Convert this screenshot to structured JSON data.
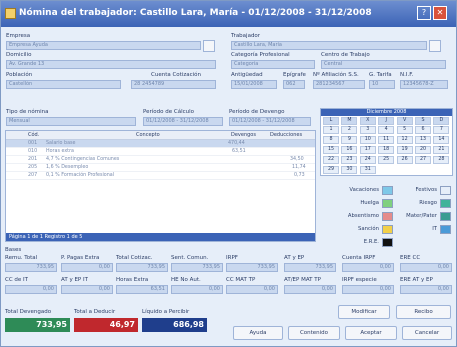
{
  "window": {
    "title": "Nómina del trabajador: Castillo Lara, María - 01/12/2008 - 31/12/2008"
  },
  "labels": {
    "empresa": "Empresa",
    "trabajador": "Trabajador",
    "domicilio": "Domicilio",
    "categoria": "Categoría Profesional",
    "centro": "Centro de Trabajo",
    "poblacion": "Población",
    "cuenta_cotizacion": "Cuenta Cotización",
    "antiguedad": "Antigüedad",
    "epigrafe": "Epígrafe",
    "afiliacion": "Nº Afiliación S.S.",
    "g_tarifa": "G. Tarifa",
    "nif": "N.I.F.",
    "tipo_nomina": "Tipo de nómina",
    "periodo_calculo": "Período de Cálculo",
    "periodo_devengo": "Período de Devengo",
    "bases": "Bases"
  },
  "fields": {
    "empresa": "Empresa Ayuda",
    "trabajador": "Castillo Lara, María",
    "domicilio": "Av. Grande 13",
    "categoria": "Categoría",
    "centro": "Central",
    "poblacion": "Castellón",
    "cuenta_cotizacion": "28 2454789",
    "antiguedad": "15/01/2008",
    "epigrafe": "062",
    "afiliacion": "281234567",
    "g_tarifa": "10",
    "nif": "12345678-Z",
    "tipo_nomina": "Mensual",
    "periodo_calculo": "01/12/2008 - 31/12/2008",
    "periodo_devengo": "01/12/2008 - 31/12/2008"
  },
  "grid": {
    "headers": [
      "Cód.",
      "Concepto",
      "Devengos",
      "Deducciones"
    ],
    "rows": [
      {
        "code": "001",
        "concept": "Salario base",
        "dev": "470,44",
        "ded": ""
      },
      {
        "code": "010",
        "concept": "Horas extra",
        "dev": "63,51",
        "ded": ""
      },
      {
        "code": "201",
        "concept": "4,7 % Contingencias Comunes",
        "dev": "",
        "ded": "34,50"
      },
      {
        "code": "205",
        "concept": "1,6 % Desempleo",
        "dev": "",
        "ded": "11,74"
      },
      {
        "code": "207",
        "concept": "0,1 % Formación Profesional",
        "dev": "",
        "ded": "0,73"
      }
    ],
    "footer": "Página 1 de 1   Registro 1 de 5"
  },
  "calendar": {
    "header": "Diciembre 2008",
    "weekdays": [
      "L",
      "M",
      "X",
      "J",
      "V",
      "S",
      "D"
    ],
    "days": [
      "1",
      "2",
      "3",
      "4",
      "5",
      "6",
      "7",
      "8",
      "9",
      "10",
      "11",
      "12",
      "13",
      "14",
      "15",
      "16",
      "17",
      "18",
      "19",
      "20",
      "21",
      "22",
      "23",
      "24",
      "25",
      "26",
      "27",
      "28",
      "29",
      "30",
      "31"
    ]
  },
  "legend": {
    "vacaciones": "Vacaciones",
    "festivos": "Festivos",
    "huelga": "Huelga",
    "riesgo": "Riesgo",
    "absentismo": "Absentismo",
    "mater_pater": "Mater/Pater",
    "sancion": "Sanción",
    "it": "IT",
    "ere": "E.R.E.",
    "colors": {
      "vacaciones": "#7ec8e8",
      "festivos": "#e6eef9",
      "huelga": "#7fd07f",
      "riesgo": "#3fb39a",
      "absentismo": "#e48c8c",
      "mater_pater": "#3a9c92",
      "sancion": "#f2d04a",
      "it": "#4a9ad8",
      "ere": "#111111"
    }
  },
  "bases": {
    "row1_labels": [
      "Remu. Total",
      "P. Pagas Extra",
      "Total Cotizac.",
      "Sent. Comun.",
      "IRPF",
      "AT y EP",
      "Cuenta IRPF",
      "ERE CC"
    ],
    "row1_values": [
      "733,95",
      "0,00",
      "733,95",
      "733,95",
      "733,95",
      "733,95",
      "0,00",
      "0,00"
    ],
    "row2_labels": [
      "CC de IT",
      "AT y EP IT",
      "Horas Extra",
      "HE No Aut.",
      "CC MAT TP",
      "AT/EP MAT TP",
      "IRPF especie",
      "ERE AT y EP"
    ],
    "row2_values": [
      "0,00",
      "0,00",
      "63,51",
      "0,00",
      "0,00",
      "0,00",
      "0,00",
      "0,00"
    ]
  },
  "totals": {
    "devengado_label": "Total Devengado",
    "devengado": "733,95",
    "deducir_label": "Total a Deducir",
    "deducir": "46,97",
    "liquido_label": "Líquido a Percibir",
    "liquido": "686,98"
  },
  "buttons": {
    "modificar": "Modificar",
    "recibo": "Recibo",
    "ayuda": "Ayuda",
    "contenido": "Contenido",
    "aceptar": "Aceptar",
    "cancelar": "Cancelar"
  }
}
